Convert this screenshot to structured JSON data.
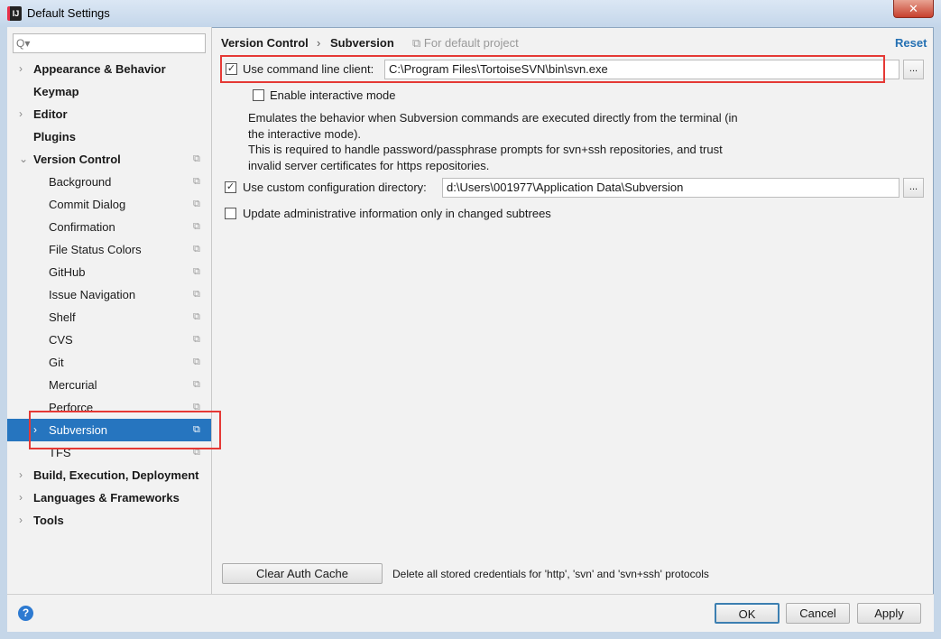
{
  "window": {
    "title": "Default Settings"
  },
  "search": {
    "placeholder": "Q▾"
  },
  "sidebar": {
    "items": [
      {
        "label": "Appearance & Behavior",
        "level": 0,
        "expandable": true
      },
      {
        "label": "Keymap",
        "level": 0,
        "expandable": false
      },
      {
        "label": "Editor",
        "level": 0,
        "expandable": true
      },
      {
        "label": "Plugins",
        "level": 0,
        "expandable": false
      },
      {
        "label": "Version Control",
        "level": 0,
        "expandable": true,
        "expanded": true
      },
      {
        "label": "Background",
        "level": 1
      },
      {
        "label": "Commit Dialog",
        "level": 1
      },
      {
        "label": "Confirmation",
        "level": 1
      },
      {
        "label": "File Status Colors",
        "level": 1
      },
      {
        "label": "GitHub",
        "level": 1
      },
      {
        "label": "Issue Navigation",
        "level": 1
      },
      {
        "label": "Shelf",
        "level": 1
      },
      {
        "label": "CVS",
        "level": 1
      },
      {
        "label": "Git",
        "level": 1
      },
      {
        "label": "Mercurial",
        "level": 1
      },
      {
        "label": "Perforce",
        "level": 1
      },
      {
        "label": "Subversion",
        "level": 1,
        "selected": true
      },
      {
        "label": "TFS",
        "level": 1
      },
      {
        "label": "Build, Execution, Deployment",
        "level": 0,
        "expandable": true
      },
      {
        "label": "Languages & Frameworks",
        "level": 0,
        "expandable": true
      },
      {
        "label": "Tools",
        "level": 0,
        "expandable": true
      }
    ]
  },
  "breadcrumb": {
    "parent": "Version Control",
    "sep": "›",
    "current": "Subversion",
    "scope": "For default project",
    "reset": "Reset"
  },
  "settings": {
    "use_cmd_client": {
      "label": "Use command line client:",
      "checked": true,
      "value": "C:\\Program Files\\TortoiseSVN\\bin\\svn.exe",
      "browse": "..."
    },
    "interactive": {
      "label": "Enable interactive mode",
      "checked": false
    },
    "description": [
      "Emulates the behavior when Subversion commands are executed directly from the terminal (in",
      "the interactive mode).",
      "This is required to handle password/passphrase prompts for svn+ssh repositories, and trust",
      "invalid server certificates for https repositories."
    ],
    "custom_config": {
      "label": "Use custom configuration directory:",
      "checked": true,
      "value": "d:\\Users\\001977\\Application Data\\Subversion",
      "browse": "..."
    },
    "update_admin": {
      "label": "Update administrative information only in changed subtrees",
      "checked": false
    }
  },
  "auth": {
    "button": "Clear Auth Cache",
    "note": "Delete all stored credentials for 'http', 'svn' and 'svn+ssh' protocols"
  },
  "footer": {
    "help": "?",
    "ok": "OK",
    "cancel": "Cancel",
    "apply": "Apply"
  },
  "colors": {
    "selection": "#2675bf",
    "highlight": "#e53935",
    "link": "#2470b3"
  }
}
